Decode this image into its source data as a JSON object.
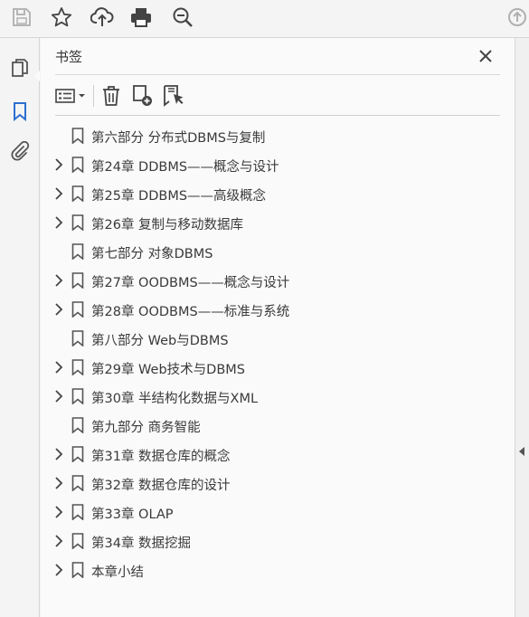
{
  "toolbar": {
    "icons": [
      "save-icon",
      "star-icon",
      "upload-cloud-icon",
      "print-icon",
      "zoom-out-icon",
      "scroll-up-icon"
    ]
  },
  "rail": {
    "icons": [
      "pages-icon",
      "bookmark-icon",
      "attachment-icon"
    ],
    "active": "bookmark-icon",
    "active_color": "#2d6fd0"
  },
  "panel": {
    "title": "书签",
    "tools": [
      "options-menu-icon",
      "delete-icon",
      "new-bookmark-icon",
      "bookmark-from-selection-icon"
    ]
  },
  "bookmarks": [
    {
      "label": "第六部分 分布式DBMS与复制",
      "expandable": false
    },
    {
      "label": "第24章 DDBMS——概念与设计",
      "expandable": true
    },
    {
      "label": "第25章 DDBMS——高级概念",
      "expandable": true
    },
    {
      "label": "第26章 复制与移动数据库",
      "expandable": true
    },
    {
      "label": "第七部分 对象DBMS",
      "expandable": false
    },
    {
      "label": "第27章 OODBMS——概念与设计",
      "expandable": true
    },
    {
      "label": "第28章 OODBMS——标准与系统",
      "expandable": true
    },
    {
      "label": "第八部分 Web与DBMS",
      "expandable": false
    },
    {
      "label": "第29章 Web技术与DBMS",
      "expandable": true
    },
    {
      "label": "第30章 半结构化数据与XML",
      "expandable": true
    },
    {
      "label": "第九部分 商务智能",
      "expandable": false
    },
    {
      "label": "第31章 数据仓库的概念",
      "expandable": true
    },
    {
      "label": "第32章 数据仓库的设计",
      "expandable": true
    },
    {
      "label": "第33章 OLAP",
      "expandable": true
    },
    {
      "label": "第34章 数据挖掘",
      "expandable": true
    },
    {
      "label": "本章小结",
      "expandable": true
    }
  ]
}
